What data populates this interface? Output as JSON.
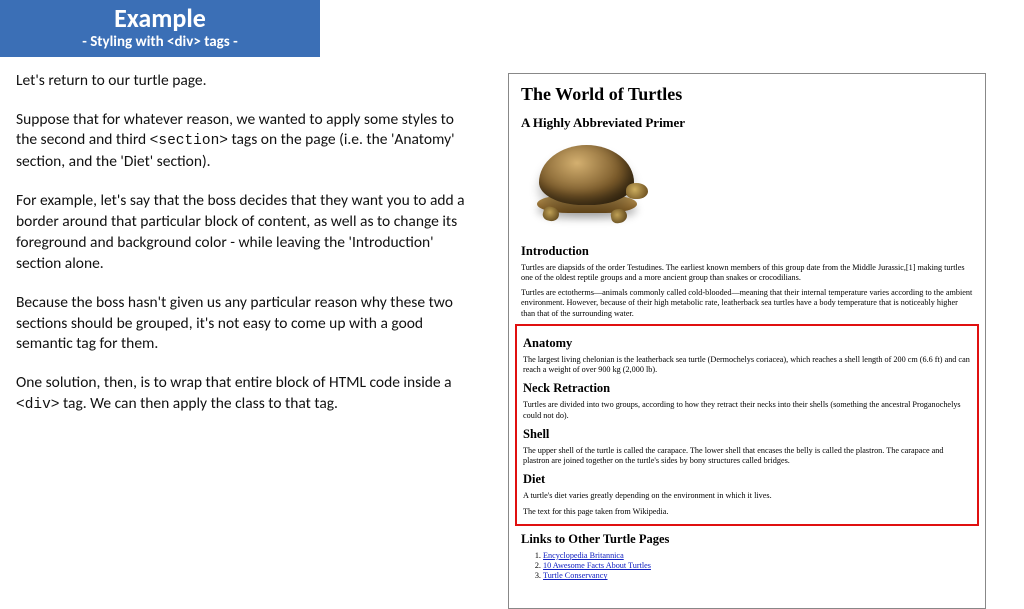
{
  "header": {
    "title": "Example",
    "subtitle": "- Styling with <div> tags -"
  },
  "left": {
    "p1": "Let's return to our turtle page.",
    "p2a": "Suppose that for whatever reason, we wanted to apply some styles to the second and third ",
    "p2code": "<section>",
    "p2b": "  tags on the page (i.e. the 'Anatomy' section, and the 'Diet' section).",
    "p3": "For example, let's say that the boss decides that they want you to add a border around that particular block of content, as well as to change its foreground and background color - while leaving the 'Introduction' section alone.",
    "p4": "Because the boss hasn't given us any particular reason why these two sections should be grouped, it's not easy to come up with a good semantic tag for them.",
    "p5a": "One solution, then, is to wrap that entire block of HTML code inside a ",
    "p5code": "<div>",
    "p5b": "  tag.  We can then apply the class to that tag."
  },
  "preview": {
    "title": "The World of Turtles",
    "subtitle": "A Highly Abbreviated Primer",
    "intro_h": "Introduction",
    "intro_p1": "Turtles are diapsids of the order Testudines. The earliest known members of this group date from the Middle Jurassic,[1] making turtles one of the oldest reptile groups and a more ancient group than snakes or crocodilians.",
    "intro_p2": "Turtles are ectotherms—animals commonly called cold-blooded—meaning that their internal temperature varies according to the ambient environment. However, because of their high metabolic rate, leatherback sea turtles have a body temperature that is noticeably higher than that of the surrounding water.",
    "anat_h": "Anatomy",
    "anat_p": "The largest living chelonian is the leatherback sea turtle (Dermochelys coriacea), which reaches a shell length of 200 cm (6.6 ft) and can reach a weight of over 900 kg (2,000 lb).",
    "neck_h": "Neck Retraction",
    "neck_p": "Turtles are divided into two groups, according to how they retract their necks into their shells (something the ancestral Proganochelys could not do).",
    "shell_h": "Shell",
    "shell_p": "The upper shell of the turtle is called the carapace. The lower shell that encases the belly is called the plastron. The carapace and plastron are joined together on the turtle's sides by bony structures called bridges.",
    "diet_h": "Diet",
    "diet_p1": "A turtle's diet varies greatly depending on the environment in which it lives.",
    "diet_p2": "The text for this page taken from Wikipedia.",
    "links_h": "Links to Other Turtle Pages",
    "links": {
      "l1": "Encyclopedia Britannica",
      "l2": "10 Awesome Facts About Turtles",
      "l3": "Turtle Conservancy"
    }
  }
}
